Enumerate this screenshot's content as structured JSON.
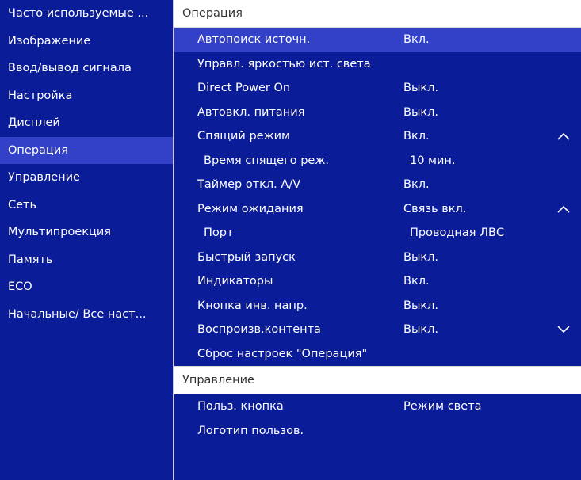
{
  "sidebar": {
    "items": [
      {
        "label": "Часто используемые ..."
      },
      {
        "label": "Изображение"
      },
      {
        "label": "Ввод/вывод сигнала"
      },
      {
        "label": "Настройка"
      },
      {
        "label": "Дисплей"
      },
      {
        "label": "Операция",
        "active": true
      },
      {
        "label": "Управление"
      },
      {
        "label": "Сеть"
      },
      {
        "label": "Мультипроекция"
      },
      {
        "label": "Память"
      },
      {
        "label": "ECO"
      },
      {
        "label": "Начальные/ Все наст..."
      }
    ]
  },
  "main": {
    "section1": {
      "title": "Операция",
      "rows": [
        {
          "label": "Автопоиск источн.",
          "value": "Вкл."
        },
        {
          "label": "Управл. яркостью ист. света",
          "value": ""
        },
        {
          "label": "Direct Power On",
          "value": "Выкл."
        },
        {
          "label": "Автовкл. питания",
          "value": "Выкл."
        },
        {
          "label": "Спящий режим",
          "value": "Вкл."
        },
        {
          "label": "Время спящего реж.",
          "value": "10 мин."
        },
        {
          "label": "Таймер откл. A/V",
          "value": "Вкл."
        },
        {
          "label": "Режим ожидания",
          "value": "Связь вкл."
        },
        {
          "label": "Порт",
          "value": "Проводная ЛВС"
        },
        {
          "label": "Быстрый запуск",
          "value": "Выкл."
        },
        {
          "label": "Индикаторы",
          "value": "Вкл."
        },
        {
          "label": "Кнопка инв. напр.",
          "value": "Выкл."
        },
        {
          "label": "Воспроизв.контента",
          "value": "Выкл."
        },
        {
          "label": "Сброс настроек \"Операция\"",
          "value": ""
        }
      ]
    },
    "section2": {
      "title": "Управление",
      "rows": [
        {
          "label": "Польз. кнопка",
          "value": "Режим света"
        },
        {
          "label": "Логотип пользов.",
          "value": ""
        }
      ]
    }
  },
  "icons": {
    "expanded": "chevron-up-icon",
    "collapsed": "chevron-down-icon"
  },
  "colors": {
    "menu_background": "#0b1c98",
    "selection": "#3341c8",
    "text": "#ffffff",
    "section_header_background": "#ffffff"
  }
}
